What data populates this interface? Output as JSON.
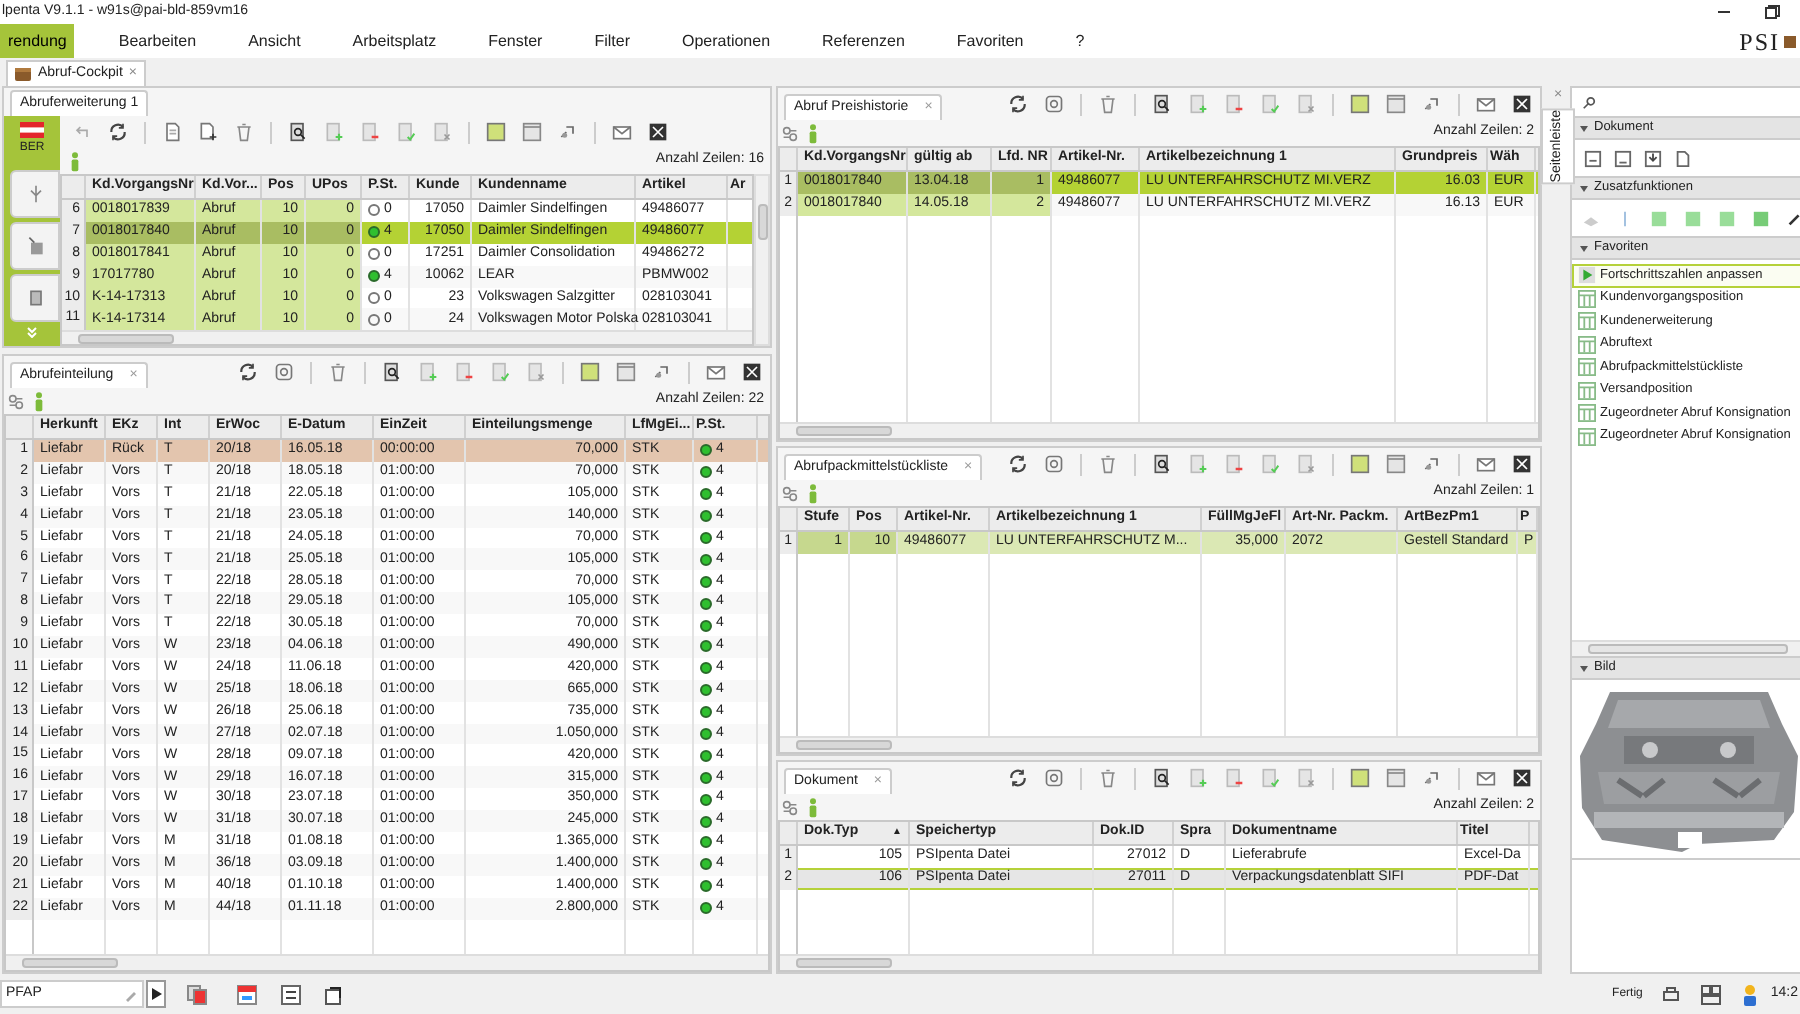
{
  "window": {
    "title": "lpenta V9.1.1 - w91s@pai-bld-859vm16",
    "logo": "PSI"
  },
  "menu": [
    {
      "label": "rendung",
      "selected": true
    },
    {
      "label": "Bearbeiten",
      "selected": false
    },
    {
      "label": "Ansicht",
      "selected": false
    },
    {
      "label": "Arbeitsplatz",
      "selected": false
    },
    {
      "label": "Fenster",
      "selected": false
    },
    {
      "label": "Filter",
      "selected": false
    },
    {
      "label": "Operationen",
      "selected": false
    },
    {
      "label": "Referenzen",
      "selected": false
    },
    {
      "label": "Favoriten",
      "selected": false
    },
    {
      "label": "?",
      "selected": false
    }
  ],
  "document_tab": {
    "label": "Abruf-Cockpit",
    "close": "×"
  },
  "panels": {
    "abruferweiterung": {
      "tab": "Abruferweiterung 1",
      "region": "BER",
      "count": "Anzahl Zeilen: 16",
      "columns": [
        {
          "label": "Kd.VorgangsNr",
          "key": true
        },
        {
          "label": "Kd.Vor...",
          "key": true
        },
        {
          "label": "Pos",
          "key": true
        },
        {
          "label": "UPos",
          "key": true
        },
        {
          "label": "P.St.",
          "key": false
        },
        {
          "label": "Kunde",
          "key": false
        },
        {
          "label": "Kundenname",
          "key": false
        },
        {
          "label": "Artikel",
          "key": false
        },
        {
          "label": "Ar",
          "key": false
        }
      ],
      "rows": [
        {
          "n": "6",
          "selected": false,
          "lit": false,
          "cells": [
            "0018017839",
            "Abruf",
            "10",
            "0",
            "0",
            "17050",
            "Daimler Sindelfingen",
            "49486077"
          ]
        },
        {
          "n": "7",
          "selected": true,
          "lit": true,
          "cells": [
            "0018017840",
            "Abruf",
            "10",
            "0",
            "4",
            "17050",
            "Daimler Sindelfingen",
            "49486077"
          ]
        },
        {
          "n": "8",
          "selected": false,
          "lit": false,
          "cells": [
            "0018017841",
            "Abruf",
            "10",
            "0",
            "0",
            "17251",
            "Daimler Consolidation",
            "49486272"
          ]
        },
        {
          "n": "9",
          "selected": false,
          "lit": true,
          "cells": [
            "17017780",
            "Abruf",
            "10",
            "0",
            "4",
            "10062",
            "LEAR",
            "PBMW002"
          ]
        },
        {
          "n": "10",
          "selected": false,
          "lit": false,
          "cells": [
            "K-14-17313",
            "Abruf",
            "10",
            "0",
            "0",
            "23",
            "Volkswagen Salzgitter",
            "028103041"
          ]
        },
        {
          "n": "11",
          "selected": false,
          "lit": false,
          "cells": [
            "K-14-17314",
            "Abruf",
            "10",
            "0",
            "0",
            "24",
            "Volkswagen Motor Polska",
            "028103041"
          ]
        }
      ]
    },
    "abrufeinteilung": {
      "tab": "Abrufeinteilung",
      "close": "×",
      "count": "Anzahl Zeilen: 22",
      "columns": [
        {
          "label": "Herkunft",
          "key": false
        },
        {
          "label": "EKz",
          "key": false
        },
        {
          "label": "Int",
          "key": false
        },
        {
          "label": "ErWoc",
          "key": false
        },
        {
          "label": "E-Datum",
          "key": false
        },
        {
          "label": "EinZeit",
          "key": false
        },
        {
          "label": "Einteilungsmenge",
          "key": false
        },
        {
          "label": "LfMgEi...",
          "key": false
        },
        {
          "label": "P.St.",
          "key": false
        }
      ],
      "rows": [
        {
          "n": "1",
          "selected": true,
          "lit": true,
          "cells": [
            "Liefabr",
            "Rück",
            "T",
            "20/18",
            "16.05.18",
            "00:00:00",
            "70,000",
            "STK",
            "4"
          ]
        },
        {
          "n": "2",
          "selected": false,
          "lit": true,
          "cells": [
            "Liefabr",
            "Vors",
            "T",
            "20/18",
            "18.05.18",
            "01:00:00",
            "70,000",
            "STK",
            "4"
          ]
        },
        {
          "n": "3",
          "selected": false,
          "lit": true,
          "cells": [
            "Liefabr",
            "Vors",
            "T",
            "21/18",
            "22.05.18",
            "01:00:00",
            "105,000",
            "STK",
            "4"
          ]
        },
        {
          "n": "4",
          "selected": false,
          "lit": true,
          "cells": [
            "Liefabr",
            "Vors",
            "T",
            "21/18",
            "23.05.18",
            "01:00:00",
            "140,000",
            "STK",
            "4"
          ]
        },
        {
          "n": "5",
          "selected": false,
          "lit": true,
          "cells": [
            "Liefabr",
            "Vors",
            "T",
            "21/18",
            "24.05.18",
            "01:00:00",
            "70,000",
            "STK",
            "4"
          ]
        },
        {
          "n": "6",
          "selected": false,
          "lit": true,
          "cells": [
            "Liefabr",
            "Vors",
            "T",
            "21/18",
            "25.05.18",
            "01:00:00",
            "105,000",
            "STK",
            "4"
          ]
        },
        {
          "n": "7",
          "selected": false,
          "lit": true,
          "cells": [
            "Liefabr",
            "Vors",
            "T",
            "22/18",
            "28.05.18",
            "01:00:00",
            "70,000",
            "STK",
            "4"
          ]
        },
        {
          "n": "8",
          "selected": false,
          "lit": true,
          "cells": [
            "Liefabr",
            "Vors",
            "T",
            "22/18",
            "29.05.18",
            "01:00:00",
            "105,000",
            "STK",
            "4"
          ]
        },
        {
          "n": "9",
          "selected": false,
          "lit": true,
          "cells": [
            "Liefabr",
            "Vors",
            "T",
            "22/18",
            "30.05.18",
            "01:00:00",
            "70,000",
            "STK",
            "4"
          ]
        },
        {
          "n": "10",
          "selected": false,
          "lit": true,
          "cells": [
            "Liefabr",
            "Vors",
            "W",
            "23/18",
            "04.06.18",
            "01:00:00",
            "490,000",
            "STK",
            "4"
          ]
        },
        {
          "n": "11",
          "selected": false,
          "lit": true,
          "cells": [
            "Liefabr",
            "Vors",
            "W",
            "24/18",
            "11.06.18",
            "01:00:00",
            "420,000",
            "STK",
            "4"
          ]
        },
        {
          "n": "12",
          "selected": false,
          "lit": true,
          "cells": [
            "Liefabr",
            "Vors",
            "W",
            "25/18",
            "18.06.18",
            "01:00:00",
            "665,000",
            "STK",
            "4"
          ]
        },
        {
          "n": "13",
          "selected": false,
          "lit": true,
          "cells": [
            "Liefabr",
            "Vors",
            "W",
            "26/18",
            "25.06.18",
            "01:00:00",
            "735,000",
            "STK",
            "4"
          ]
        },
        {
          "n": "14",
          "selected": false,
          "lit": true,
          "cells": [
            "Liefabr",
            "Vors",
            "W",
            "27/18",
            "02.07.18",
            "01:00:00",
            "1.050,000",
            "STK",
            "4"
          ]
        },
        {
          "n": "15",
          "selected": false,
          "lit": true,
          "cells": [
            "Liefabr",
            "Vors",
            "W",
            "28/18",
            "09.07.18",
            "01:00:00",
            "420,000",
            "STK",
            "4"
          ]
        },
        {
          "n": "16",
          "selected": false,
          "lit": true,
          "cells": [
            "Liefabr",
            "Vors",
            "W",
            "29/18",
            "16.07.18",
            "01:00:00",
            "315,000",
            "STK",
            "4"
          ]
        },
        {
          "n": "17",
          "selected": false,
          "lit": true,
          "cells": [
            "Liefabr",
            "Vors",
            "W",
            "30/18",
            "23.07.18",
            "01:00:00",
            "350,000",
            "STK",
            "4"
          ]
        },
        {
          "n": "18",
          "selected": false,
          "lit": true,
          "cells": [
            "Liefabr",
            "Vors",
            "W",
            "31/18",
            "30.07.18",
            "01:00:00",
            "245,000",
            "STK",
            "4"
          ]
        },
        {
          "n": "19",
          "selected": false,
          "lit": true,
          "cells": [
            "Liefabr",
            "Vors",
            "M",
            "31/18",
            "01.08.18",
            "01:00:00",
            "1.365,000",
            "STK",
            "4"
          ]
        },
        {
          "n": "20",
          "selected": false,
          "lit": true,
          "cells": [
            "Liefabr",
            "Vors",
            "M",
            "36/18",
            "03.09.18",
            "01:00:00",
            "1.400,000",
            "STK",
            "4"
          ]
        },
        {
          "n": "21",
          "selected": false,
          "lit": true,
          "cells": [
            "Liefabr",
            "Vors",
            "M",
            "40/18",
            "01.10.18",
            "01:00:00",
            "1.400,000",
            "STK",
            "4"
          ]
        },
        {
          "n": "22",
          "selected": false,
          "lit": true,
          "cells": [
            "Liefabr",
            "Vors",
            "M",
            "44/18",
            "01.11.18",
            "01:00:00",
            "2.800,000",
            "STK",
            "4"
          ]
        }
      ]
    },
    "preishistorie": {
      "tab": "Abruf Preishistorie",
      "close": "×",
      "count": "Anzahl Zeilen: 2",
      "columns": [
        {
          "label": "Kd.VorgangsNr",
          "key": true
        },
        {
          "label": "gültig ab",
          "key": true
        },
        {
          "label": "Lfd. NR",
          "key": true
        },
        {
          "label": "Artikel-Nr.",
          "key": false
        },
        {
          "label": "Artikelbezeichnung 1",
          "key": false
        },
        {
          "label": "Grundpreis",
          "key": false
        },
        {
          "label": "Wäh",
          "key": false
        }
      ],
      "rows": [
        {
          "n": "1",
          "selected": true,
          "cells": [
            "0018017840",
            "13.04.18",
            "1",
            "49486077",
            "LU UNTERFAHRSCHUTZ MI.VERZ",
            "16.03",
            "EUR"
          ]
        },
        {
          "n": "2",
          "selected": false,
          "cells": [
            "0018017840",
            "14.05.18",
            "2",
            "49486077",
            "LU UNTERFAHRSCHUTZ MI.VERZ",
            "16.13",
            "EUR"
          ]
        }
      ]
    },
    "packmittel": {
      "tab": "Abrufpackmittelstückliste",
      "close": "×",
      "count": "Anzahl Zeilen: 1",
      "columns": [
        {
          "label": "Stufe",
          "key": true
        },
        {
          "label": "Pos",
          "key": true
        },
        {
          "label": "Artikel-Nr.",
          "key": false
        },
        {
          "label": "Artikelbezeichnung 1",
          "key": false
        },
        {
          "label": "FüllMgJeFl",
          "key": false
        },
        {
          "label": "Art-Nr. Packm.",
          "key": false
        },
        {
          "label": "ArtBezPm1",
          "key": false
        },
        {
          "label": "P",
          "key": false
        }
      ],
      "rows": [
        {
          "n": "1",
          "selected": true,
          "cells": [
            "1",
            "10",
            "49486077",
            "LU UNTERFAHRSCHUTZ M...",
            "35,000",
            "2072",
            "Gestell Standard",
            "P"
          ]
        }
      ]
    },
    "dokument": {
      "tab": "Dokument",
      "close": "×",
      "count": "Anzahl Zeilen: 2",
      "columns": [
        {
          "label": "Dok.Typ",
          "key": false,
          "sort": "▲"
        },
        {
          "label": "Speichertyp",
          "key": false
        },
        {
          "label": "Dok.ID",
          "key": false
        },
        {
          "label": "Spra",
          "key": false
        },
        {
          "label": "Dokumentname",
          "key": false
        },
        {
          "label": "Titel",
          "key": false
        }
      ],
      "rows": [
        {
          "n": "1",
          "selected": false,
          "cells": [
            "105",
            "PSIpenta Datei",
            "27012",
            "D",
            "Lieferabrufe",
            "Excel-Da"
          ]
        },
        {
          "n": "2",
          "selected": true,
          "cells": [
            "106",
            "PSIpenta Datei",
            "27011",
            "D",
            "Verpackungsdatenblatt SIFI",
            "PDF-Dat"
          ]
        }
      ]
    }
  },
  "sidebar": {
    "tab": "Seitenleiste",
    "close": "×",
    "sections": [
      {
        "title": "Dokument",
        "kind": "document_icons"
      },
      {
        "title": "Zusatzfunktionen",
        "kind": "function_icons"
      },
      {
        "title": "Favoriten",
        "kind": "list",
        "items": [
          {
            "label": "Fortschrittszahlen anpassen",
            "selected": true,
            "kind": "action"
          },
          {
            "label": "Kundenvorgangsposition",
            "selected": false,
            "kind": "table"
          },
          {
            "label": "Kundenerweiterung",
            "selected": false,
            "kind": "table"
          },
          {
            "label": "Abruftext",
            "selected": false,
            "kind": "table"
          },
          {
            "label": "Abrufpackmittelstückliste",
            "selected": false,
            "kind": "table"
          },
          {
            "label": "Versandposition",
            "selected": false,
            "kind": "table"
          },
          {
            "label": "Zugeordneter Abruf Konsignation",
            "selected": false,
            "kind": "table"
          },
          {
            "label": "Zugeordneter Abruf Konsignation",
            "selected": false,
            "kind": "table"
          }
        ]
      },
      {
        "title": "Bild",
        "kind": "picture"
      }
    ]
  },
  "status_bar": {
    "field_value": "PFAP",
    "status": "Fertig",
    "time": "14:2"
  }
}
